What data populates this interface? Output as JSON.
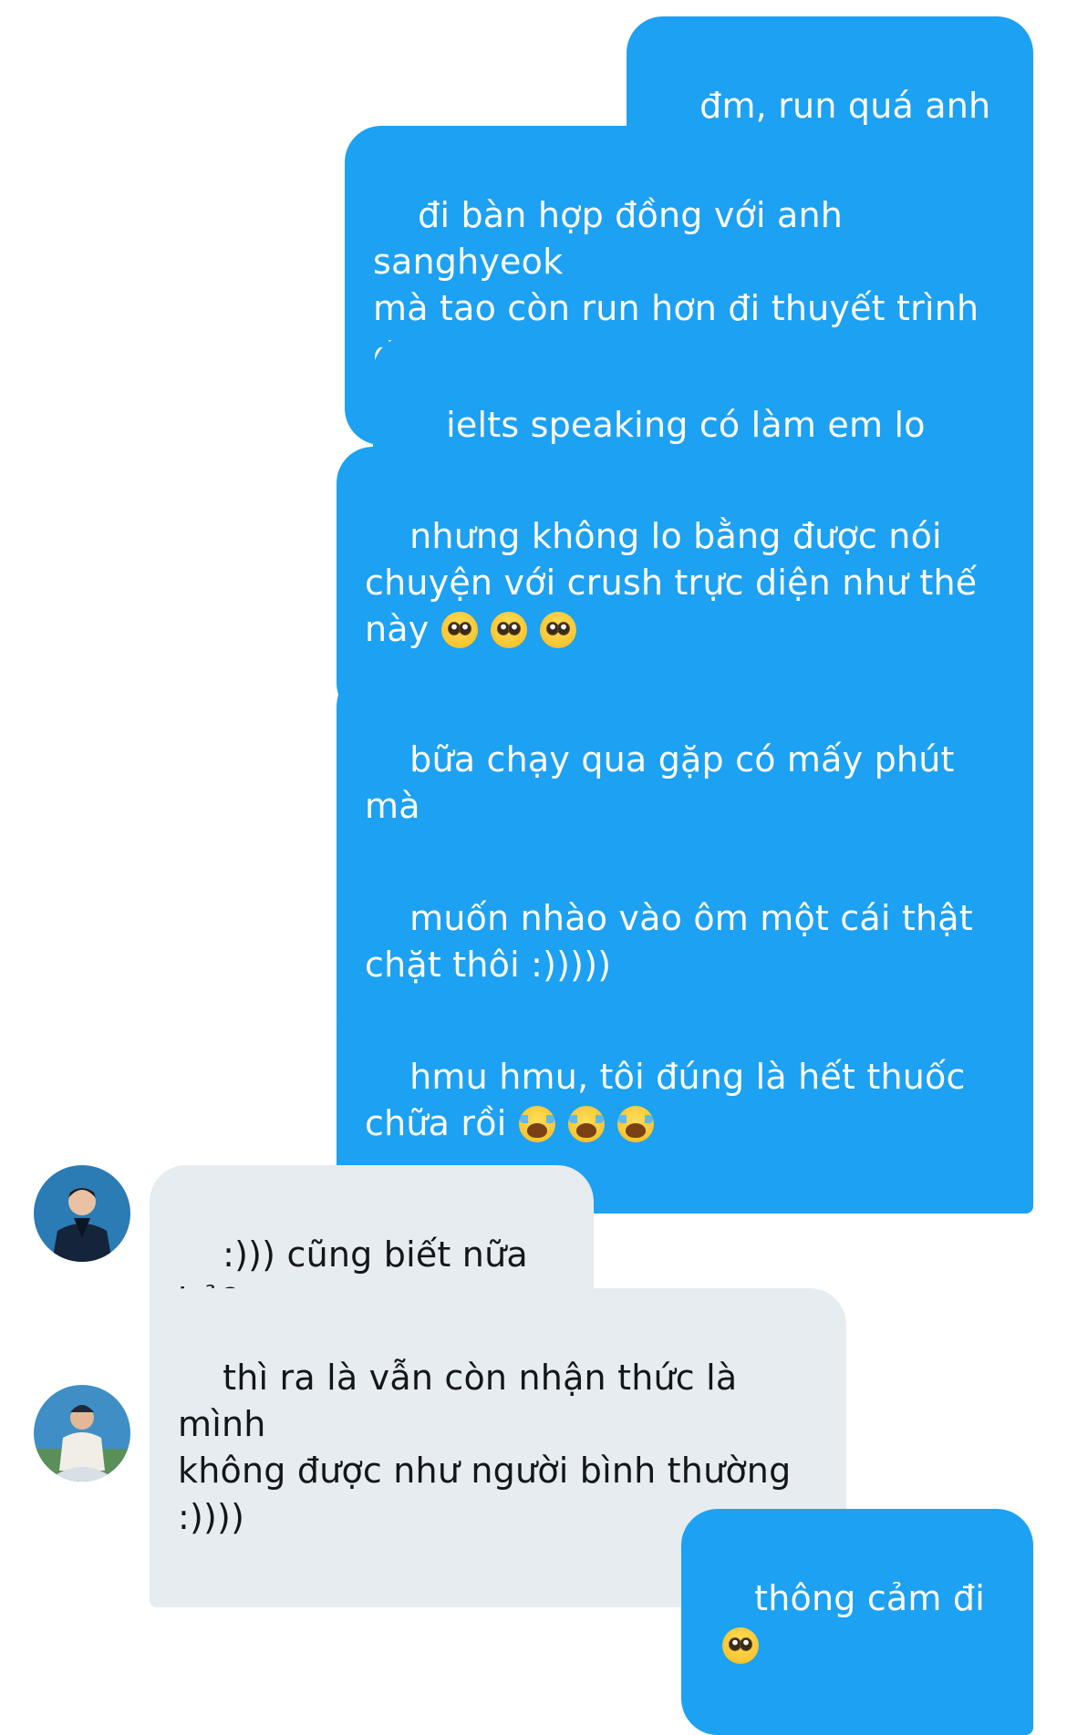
{
  "conversation": {
    "messages": [
      {
        "sender": "self",
        "text": "đm, run quá anh em ơi"
      },
      {
        "sender": "self",
        "text": "đi bàn hợp đồng với anh sanghyeok\nmà tao còn run hơn đi thuyết trình\ndự án nữa"
      },
      {
        "sender": "self",
        "text": "ielts speaking có làm em lo lắng?"
      },
      {
        "sender": "self",
        "text": "nhưng không lo bằng được nói\nchuyện với crush trực diện như thế\nnày",
        "emojis": [
          "pleading-face",
          "pleading-face",
          "pleading-face"
        ]
      },
      {
        "sender": "self",
        "text": "bữa chạy qua gặp có mấy phút mà\nảnh thơm điên đảo"
      },
      {
        "sender": "self",
        "text": "muốn nhào vào ôm một cái thật\nchặt thôi :)))))"
      },
      {
        "sender": "self",
        "text": "hmu hmu, tôi đúng là hết thuốc\nchữa rồi",
        "emojis": [
          "loudly-crying-face",
          "loudly-crying-face",
          "loudly-crying-face"
        ]
      },
      {
        "sender": "other",
        "text": ":))) cũng biết nữa hả?"
      },
      {
        "sender": "other",
        "text": "thì ra là vẫn còn nhận thức là mình\nkhông được như người bình thường\n:))))"
      },
      {
        "sender": "self",
        "text": "thông cảm đi",
        "emojis": [
          "pleading-face"
        ]
      }
    ]
  },
  "colors": {
    "outgoing_bubble": "#1da1f2",
    "outgoing_text": "#ffffff",
    "incoming_bubble": "#e6ecf0",
    "incoming_text": "#14171a"
  }
}
